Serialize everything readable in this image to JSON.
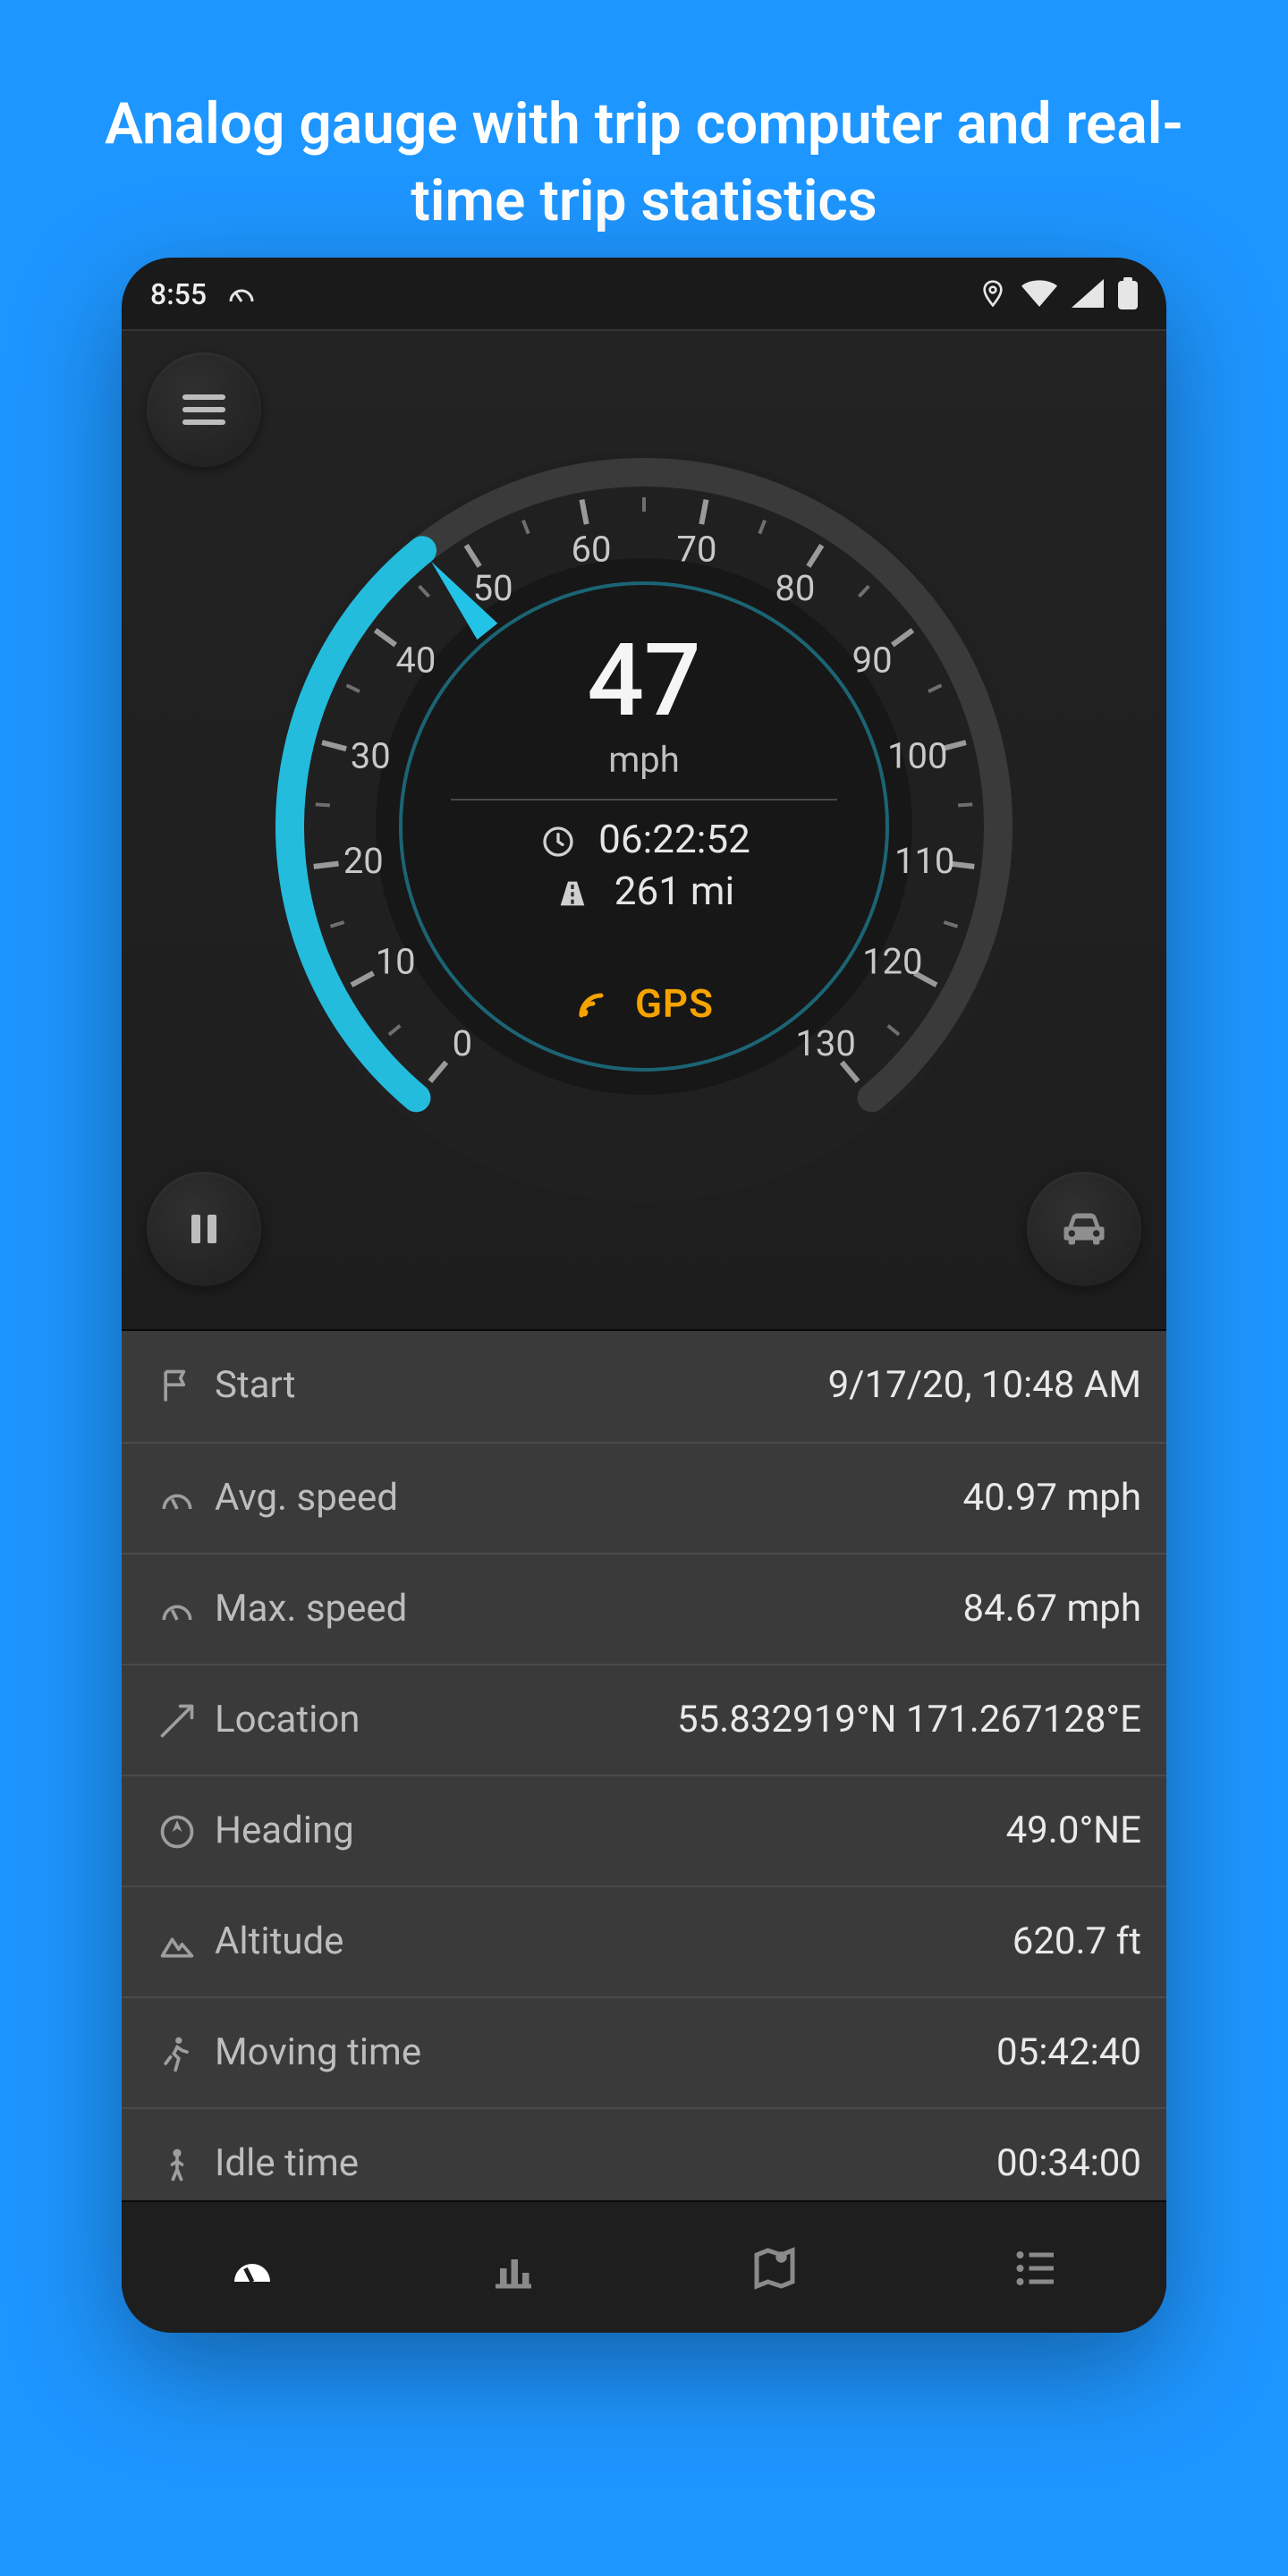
{
  "promo": {
    "title": "Analog gauge with trip computer and real-time trip statistics"
  },
  "statusbar": {
    "time": "8:55"
  },
  "gauge": {
    "speed_value": "47",
    "speed_unit": "mph",
    "elapsed": "06:22:52",
    "distance": "261 mi",
    "signal_label": "GPS",
    "max_tick": 130,
    "major_step": 10,
    "current_speed": 47
  },
  "stats": [
    {
      "icon": "flag-icon",
      "label": "Start",
      "value": "9/17/20, 10:48 AM"
    },
    {
      "icon": "gauge-icon",
      "label": "Avg. speed",
      "value": "40.97 mph"
    },
    {
      "icon": "gauge-icon",
      "label": "Max. speed",
      "value": "84.67 mph"
    },
    {
      "icon": "arrow-icon",
      "label": "Location",
      "value": "55.832919°N  171.267128°E"
    },
    {
      "icon": "compass-icon",
      "label": "Heading",
      "value": "49.0°NE"
    },
    {
      "icon": "mountain-icon",
      "label": "Altitude",
      "value": "620.7 ft"
    },
    {
      "icon": "walk-icon",
      "label": "Moving time",
      "value": "05:42:40"
    },
    {
      "icon": "person-icon",
      "label": "Idle time",
      "value": "00:34:00"
    }
  ],
  "nav": {
    "items": [
      "dashboard",
      "chart",
      "map",
      "list"
    ],
    "active": 0
  },
  "colors": {
    "accent": "#22c3e6",
    "gps": "#f6a300"
  }
}
